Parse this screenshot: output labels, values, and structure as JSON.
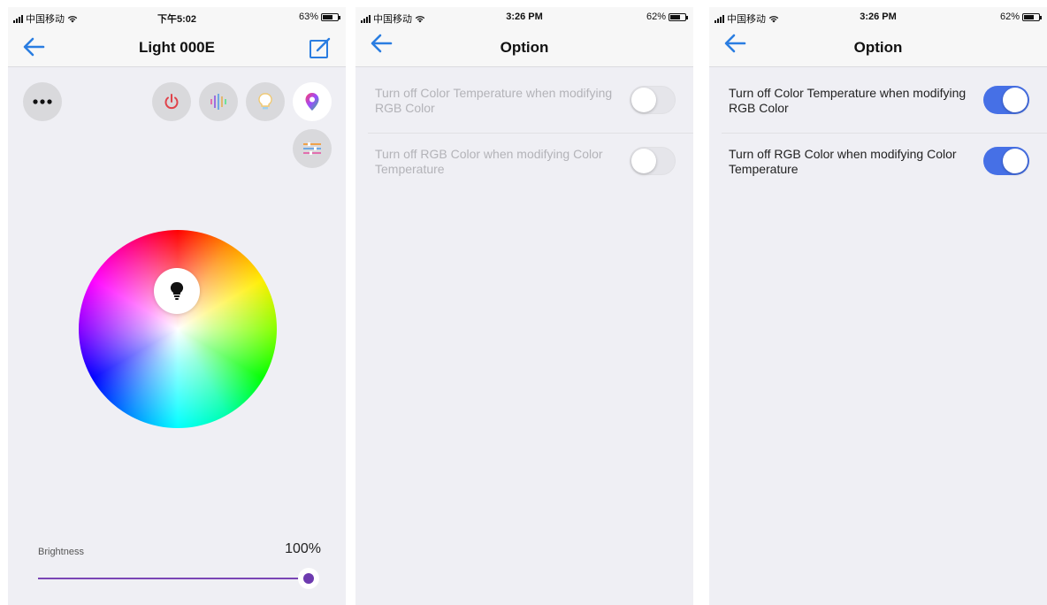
{
  "screen1": {
    "status": {
      "carrier": "中国移动",
      "time": "下午5:02",
      "battery": "63%"
    },
    "title": "Light 000E",
    "brightness": {
      "label": "Brightness",
      "value": "100%",
      "level": 1.0
    },
    "colors": {
      "accent": "#2a7de1",
      "slider": "#7a45b5",
      "power": "#e0424a"
    }
  },
  "screen2": {
    "status": {
      "carrier": "中国移动",
      "time": "3:26 PM",
      "battery": "62%"
    },
    "title": "Option",
    "options": [
      {
        "label": "Turn off Color Temperature when modifying RGB Color",
        "on": false
      },
      {
        "label": "Turn off RGB Color when modifying Color Temperature",
        "on": false
      }
    ]
  },
  "screen3": {
    "status": {
      "carrier": "中国移动",
      "time": "3:26 PM",
      "battery": "62%"
    },
    "title": "Option",
    "options": [
      {
        "label": "Turn off Color Temperature when modifying RGB Color",
        "on": true
      },
      {
        "label": "Turn off RGB Color when modifying Color Temperature",
        "on": true
      }
    ],
    "colors": {
      "toggle_on": "#4670e6"
    }
  }
}
